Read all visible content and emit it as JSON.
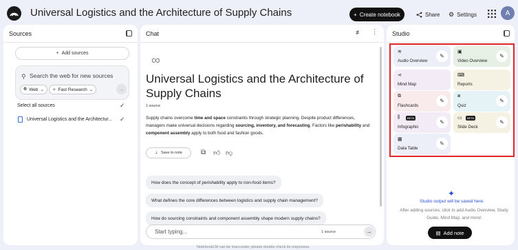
{
  "header": {
    "title": "Universal Logistics and the Architecture of Supply Chains",
    "create_label": "Create notebook",
    "share_label": "Share",
    "settings_label": "Settings",
    "avatar_letter": "A"
  },
  "sources": {
    "title": "Sources",
    "add_label": "Add sources",
    "search_placeholder": "Search the web for new sources",
    "chip_web": "Web",
    "chip_research": "Fast Research",
    "select_all": "Select all sources",
    "items": [
      {
        "label": "Universal Logistics and the Architectur..."
      }
    ]
  },
  "chat": {
    "title": "Chat",
    "doc_title": "Universal Logistics and the Architecture of Supply Chains",
    "source_count": "1 source",
    "summary_parts": [
      "Supply chains overcome ",
      "time and space",
      " constraints through strategic planning. Despite product differences, managers make universal decisions regarding ",
      "sourcing, inventory, and forecasting",
      ". Factors like ",
      "perishability",
      " and ",
      "component assembly",
      " apply to both food and fashion goods."
    ],
    "save_note": "Save to note",
    "suggestions": [
      "How does the concept of perishability apply to non-food items?",
      "What defines the core differences between logistics and supply chain management?",
      "How do sourcing constraints and component assembly shape modern supply chains?"
    ],
    "input_placeholder": "Start typing...",
    "input_source_count": "1 source",
    "disclaimer": "NotebookLM can be inaccurate; please double check its responses."
  },
  "studio": {
    "title": "Studio",
    "tiles": [
      {
        "label": "Audio Overview",
        "icon": "audio-icon",
        "color": "#eceff8"
      },
      {
        "label": "Video Overview",
        "icon": "video-icon",
        "color": "#e7f0e5"
      },
      {
        "label": "Mind Map",
        "icon": "mindmap-icon",
        "color": "#f3ebf6"
      },
      {
        "label": "Reports",
        "icon": "reports-icon",
        "color": "#f5f1e3"
      },
      {
        "label": "Flashcards",
        "icon": "flashcards-icon",
        "color": "#f9eaec"
      },
      {
        "label": "Quiz",
        "icon": "quiz-icon",
        "color": "#e5f3f6"
      },
      {
        "label": "Infographic",
        "icon": "infographic-icon",
        "color": "#f3ebf6"
      },
      {
        "label": "Slide Deck",
        "icon": "slides-icon",
        "color": "#f5f1e3"
      },
      {
        "label": "Data Table",
        "icon": "table-icon",
        "color": "#eceff8"
      }
    ],
    "beta_label": "BETA",
    "output_msg": "Studio output will be saved here.",
    "help_msg": "After adding sources, click to add Audio Overview, Study Guide, Mind Map, and more!",
    "add_note": "Add note"
  }
}
